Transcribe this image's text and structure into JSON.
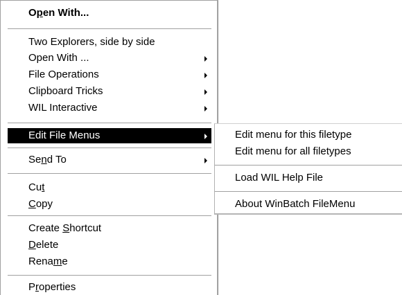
{
  "main_menu": {
    "open_with_default": {
      "pre": "O",
      "ul": "p",
      "post": "en With..."
    },
    "two_explorers": "Two Explorers, side by side",
    "open_with_submenu": "Open With ...",
    "file_operations": "File Operations",
    "clipboard_tricks": "Clipboard Tricks",
    "wil_interactive": "WIL Interactive",
    "edit_file_menus": "Edit File Menus",
    "send_to": {
      "pre": "Se",
      "ul": "n",
      "post": "d To"
    },
    "cut": {
      "pre": "Cu",
      "ul": "t",
      "post": ""
    },
    "copy": {
      "pre": "",
      "ul": "C",
      "post": "opy"
    },
    "create_shortcut": {
      "pre": "Create ",
      "ul": "S",
      "post": "hortcut"
    },
    "delete": {
      "pre": "",
      "ul": "D",
      "post": "elete"
    },
    "rename": {
      "pre": "Rena",
      "ul": "m",
      "post": "e"
    },
    "properties": {
      "pre": "P",
      "ul": "r",
      "post": "operties"
    }
  },
  "sub_menu": {
    "edit_menu_this": "Edit menu for this filetype",
    "edit_menu_all": "Edit menu for all filetypes",
    "load_help": "Load WIL Help File",
    "about": "About WinBatch FileMenu"
  },
  "colors": {
    "selected_bg": "#000000",
    "selected_fg": "#ffffff",
    "menu_bg": "#ffffff"
  }
}
